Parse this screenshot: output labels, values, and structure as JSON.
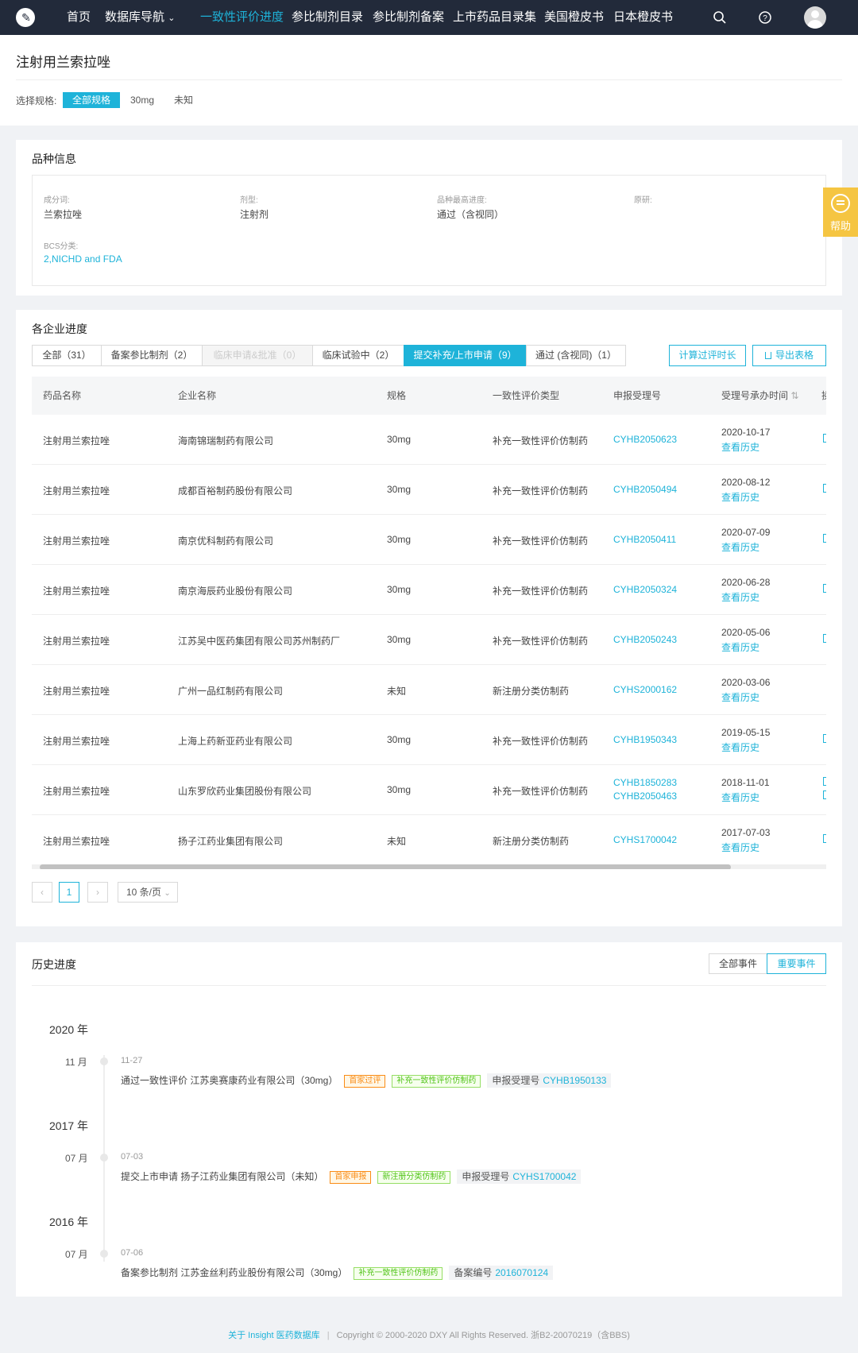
{
  "nav": {
    "items": [
      "首页",
      "数据库导航",
      "一致性评价进度",
      "参比制剂目录",
      "参比制剂备案",
      "上市药品目录集",
      "美国橙皮书",
      "日本橙皮书"
    ],
    "dropdown_arrow": "⌄",
    "logo_glyph": "✎",
    "icons": [
      "search-icon",
      "question-icon",
      "avatar"
    ]
  },
  "page": {
    "title": "注射用兰索拉唑",
    "spec_label": "选择规格:",
    "specs": [
      "全部规格",
      "30mg",
      "未知"
    ]
  },
  "help": {
    "label": "帮助"
  },
  "variety": {
    "title": "品种信息",
    "fields": [
      {
        "label": "成分词:",
        "value": "兰索拉唑"
      },
      {
        "label": "剂型:",
        "value": "注射剂"
      },
      {
        "label": "品种最高进度:",
        "value": "通过（含视同）"
      },
      {
        "label": "原研:",
        "value": ""
      },
      {
        "label": "BCS分类:",
        "value": "2,NICHD and FDA"
      }
    ]
  },
  "progress": {
    "title": "各企业进度",
    "tabs": [
      "全部（31）",
      "备案参比制剂（2）",
      "临床申请&批准（0）",
      "临床试验中（2）",
      "提交补充/上市申请（9）",
      "通过 (含视同)（1）"
    ],
    "actions": [
      "计算过评时长",
      "导出表格"
    ],
    "columns": [
      "药品名称",
      "企业名称",
      "规格",
      "一致性评价类型",
      "申报受理号",
      "受理号承办时间",
      "操"
    ],
    "sort_glyph": "⇅",
    "history_link": "查看历史",
    "rows": [
      {
        "drug": "注射用兰索拉唑",
        "company": "海南锦瑞制药有限公司",
        "spec": "30mg",
        "type": "补充一致性评价仿制药",
        "nos": [
          "CYHB2050623"
        ],
        "date": "2020-10-17"
      },
      {
        "drug": "注射用兰索拉唑",
        "company": "成都百裕制药股份有限公司",
        "spec": "30mg",
        "type": "补充一致性评价仿制药",
        "nos": [
          "CYHB2050494"
        ],
        "date": "2020-08-12"
      },
      {
        "drug": "注射用兰索拉唑",
        "company": "南京优科制药有限公司",
        "spec": "30mg",
        "type": "补充一致性评价仿制药",
        "nos": [
          "CYHB2050411"
        ],
        "date": "2020-07-09"
      },
      {
        "drug": "注射用兰索拉唑",
        "company": "南京海辰药业股份有限公司",
        "spec": "30mg",
        "type": "补充一致性评价仿制药",
        "nos": [
          "CYHB2050324"
        ],
        "date": "2020-06-28"
      },
      {
        "drug": "注射用兰索拉唑",
        "company": "江苏吴中医药集团有限公司苏州制药厂",
        "spec": "30mg",
        "type": "补充一致性评价仿制药",
        "nos": [
          "CYHB2050243"
        ],
        "date": "2020-05-06"
      },
      {
        "drug": "注射用兰索拉唑",
        "company": "广州一品红制药有限公司",
        "spec": "未知",
        "type": "新注册分类仿制药",
        "nos": [
          "CYHS2000162"
        ],
        "date": "2020-03-06"
      },
      {
        "drug": "注射用兰索拉唑",
        "company": "上海上药新亚药业有限公司",
        "spec": "30mg",
        "type": "补充一致性评价仿制药",
        "nos": [
          "CYHB1950343"
        ],
        "date": "2019-05-15"
      },
      {
        "drug": "注射用兰索拉唑",
        "company": "山东罗欣药业集团股份有限公司",
        "spec": "30mg",
        "type": "补充一致性评价仿制药",
        "nos": [
          "CYHB1850283",
          "CYHB2050463"
        ],
        "date": "2018-11-01"
      },
      {
        "drug": "注射用兰索拉唑",
        "company": "扬子江药业集团有限公司",
        "spec": "未知",
        "type": "新注册分类仿制药",
        "nos": [
          "CYHS1700042"
        ],
        "date": "2017-07-03"
      }
    ],
    "pagination": {
      "prev": "‹",
      "current": "1",
      "next": "›",
      "page_size": "10 条/页"
    }
  },
  "history": {
    "title": "历史进度",
    "filters": [
      "全部事件",
      "重要事件"
    ],
    "events": [
      {
        "year": "2020 年",
        "month": "11 月",
        "date": "11-27",
        "text": "通过一致性评价 江苏奥赛康药业有限公司（30mg）",
        "tags": [
          {
            "label": "首家过评",
            "color": "orange"
          },
          {
            "label": "补充一致性评价仿制药",
            "color": "green"
          }
        ],
        "reg_label": "申报受理号",
        "reg_value": "CYHB1950133"
      },
      {
        "year": "2017 年",
        "month": "07 月",
        "date": "07-03",
        "text": "提交上市申请 扬子江药业集团有限公司（未知）",
        "tags": [
          {
            "label": "首家申报",
            "color": "orange"
          },
          {
            "label": "新注册分类仿制药",
            "color": "green"
          }
        ],
        "reg_label": "申报受理号",
        "reg_value": "CYHS1700042"
      },
      {
        "year": "2016 年",
        "month": "07 月",
        "date": "07-06",
        "text": "备案参比制剂 江苏金丝利药业股份有限公司（30mg）",
        "tags": [
          {
            "label": "补充一致性评价仿制药",
            "color": "green"
          }
        ],
        "reg_label": "备案编号",
        "reg_value": "2016070124"
      }
    ]
  },
  "footer": {
    "link": "关于 Insight 医药数据库",
    "sep": "|",
    "text": "Copyright © 2000-2020 DXY All Rights Reserved. 浙B2-20070219（含BBS)"
  }
}
